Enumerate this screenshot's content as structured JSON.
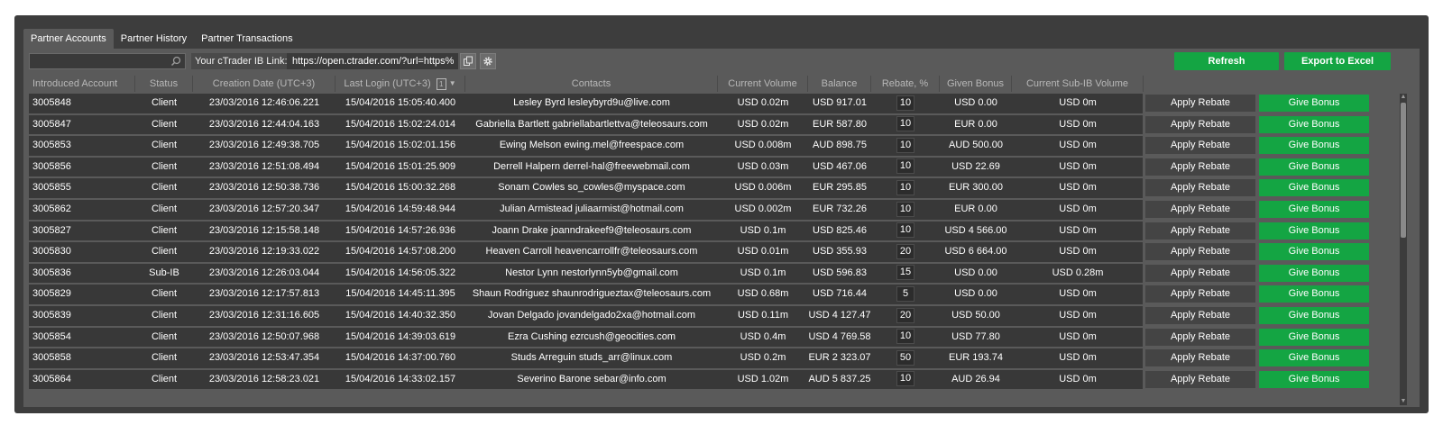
{
  "tabs": [
    {
      "label": "Partner Accounts",
      "active": true
    },
    {
      "label": "Partner History",
      "active": false
    },
    {
      "label": "Partner Transactions",
      "active": false
    }
  ],
  "toolbar": {
    "search_value": "",
    "ib_link_label": "Your cTrader IB Link:",
    "ib_link_value": "https://open.ctrader.com/?url=https%",
    "refresh_label": "Refresh",
    "export_label": "Export to Excel"
  },
  "table": {
    "columns": {
      "account": "Introduced Account",
      "status": "Status",
      "created": "Creation Date (UTC+3)",
      "last_login": "Last Login (UTC+3)",
      "sort_badge": "1",
      "contacts": "Contacts",
      "volume": "Current Volume",
      "balance": "Balance",
      "rebate": "Rebate, %",
      "bonus": "Given Bonus",
      "subib": "Current Sub-IB Volume"
    },
    "apply_label": "Apply Rebate",
    "bonus_label": "Give Bonus",
    "rows": [
      {
        "account": "3005848",
        "status": "Client",
        "created": "23/03/2016 12:46:06.221",
        "last_login": "15/04/2016 15:05:40.400",
        "contacts": "Lesley Byrd lesleybyrd9u@live.com",
        "volume": "USD 0.02m",
        "balance": "USD 917.01",
        "rebate": "10",
        "bonus": "USD 0.00",
        "subib": "USD 0m"
      },
      {
        "account": "3005847",
        "status": "Client",
        "created": "23/03/2016 12:44:04.163",
        "last_login": "15/04/2016 15:02:24.014",
        "contacts": "Gabriella Bartlett gabriellabartlettva@teleosaurs.com",
        "volume": "USD 0.02m",
        "balance": "EUR 587.80",
        "rebate": "10",
        "bonus": "EUR 0.00",
        "subib": "USD 0m"
      },
      {
        "account": "3005853",
        "status": "Client",
        "created": "23/03/2016 12:49:38.705",
        "last_login": "15/04/2016 15:02:01.156",
        "contacts": "Ewing Melson ewing.mel@freespace.com",
        "volume": "USD 0.008m",
        "balance": "AUD 898.75",
        "rebate": "10",
        "bonus": "AUD 500.00",
        "subib": "USD 0m"
      },
      {
        "account": "3005856",
        "status": "Client",
        "created": "23/03/2016 12:51:08.494",
        "last_login": "15/04/2016 15:01:25.909",
        "contacts": "Derrell Halpern derrel-hal@freewebmail.com",
        "volume": "USD 0.03m",
        "balance": "USD 467.06",
        "rebate": "10",
        "bonus": "USD 22.69",
        "subib": "USD 0m"
      },
      {
        "account": "3005855",
        "status": "Client",
        "created": "23/03/2016 12:50:38.736",
        "last_login": "15/04/2016 15:00:32.268",
        "contacts": "Sonam Cowles so_cowles@myspace.com",
        "volume": "USD 0.006m",
        "balance": "EUR 295.85",
        "rebate": "10",
        "bonus": "EUR 300.00",
        "subib": "USD 0m"
      },
      {
        "account": "3005862",
        "status": "Client",
        "created": "23/03/2016 12:57:20.347",
        "last_login": "15/04/2016 14:59:48.944",
        "contacts": "Julian Armistead juliaarmist@hotmail.com",
        "volume": "USD 0.002m",
        "balance": "EUR 732.26",
        "rebate": "10",
        "bonus": "EUR 0.00",
        "subib": "USD 0m"
      },
      {
        "account": "3005827",
        "status": "Client",
        "created": "23/03/2016 12:15:58.148",
        "last_login": "15/04/2016 14:57:26.936",
        "contacts": "Joann Drake joanndrakeef9@teleosaurs.com",
        "volume": "USD 0.1m",
        "balance": "USD 825.46",
        "rebate": "10",
        "bonus": "USD 4 566.00",
        "subib": "USD 0m"
      },
      {
        "account": "3005830",
        "status": "Client",
        "created": "23/03/2016 12:19:33.022",
        "last_login": "15/04/2016 14:57:08.200",
        "contacts": "Heaven Carroll heavencarrollfr@teleosaurs.com",
        "volume": "USD 0.01m",
        "balance": "USD 355.93",
        "rebate": "20",
        "bonus": "USD 6 664.00",
        "subib": "USD 0m"
      },
      {
        "account": "3005836",
        "status": "Sub-IB",
        "created": "23/03/2016 12:26:03.044",
        "last_login": "15/04/2016 14:56:05.322",
        "contacts": "Nestor Lynn nestorlynn5yb@gmail.com",
        "volume": "USD 0.1m",
        "balance": "USD 596.83",
        "rebate": "15",
        "bonus": "USD 0.00",
        "subib": "USD 0.28m"
      },
      {
        "account": "3005829",
        "status": "Client",
        "created": "23/03/2016 12:17:57.813",
        "last_login": "15/04/2016 14:45:11.395",
        "contacts": "Shaun Rodriguez shaunrodrigueztax@teleosaurs.com",
        "volume": "USD 0.68m",
        "balance": "USD 716.44",
        "rebate": "5",
        "bonus": "USD 0.00",
        "subib": "USD 0m"
      },
      {
        "account": "3005839",
        "status": "Client",
        "created": "23/03/2016 12:31:16.605",
        "last_login": "15/04/2016 14:40:32.350",
        "contacts": "Jovan Delgado jovandelgado2xa@hotmail.com",
        "volume": "USD 0.11m",
        "balance": "USD 4 127.47",
        "rebate": "20",
        "bonus": "USD 50.00",
        "subib": "USD 0m"
      },
      {
        "account": "3005854",
        "status": "Client",
        "created": "23/03/2016 12:50:07.968",
        "last_login": "15/04/2016 14:39:03.619",
        "contacts": "Ezra Cushing ezrcush@geocities.com",
        "volume": "USD 0.4m",
        "balance": "USD 4 769.58",
        "rebate": "10",
        "bonus": "USD 77.80",
        "subib": "USD 0m"
      },
      {
        "account": "3005858",
        "status": "Client",
        "created": "23/03/2016 12:53:47.354",
        "last_login": "15/04/2016 14:37:00.760",
        "contacts": "Studs Arreguin studs_arr@linux.com",
        "volume": "USD 0.2m",
        "balance": "EUR 2 323.07",
        "rebate": "50",
        "bonus": "EUR 193.74",
        "subib": "USD 0m"
      },
      {
        "account": "3005864",
        "status": "Client",
        "created": "23/03/2016 12:58:23.021",
        "last_login": "15/04/2016 14:33:02.157",
        "contacts": "Severino Barone sebar@info.com",
        "volume": "USD 1.02m",
        "balance": "AUD 5 837.25",
        "rebate": "10",
        "bonus": "AUD 26.94",
        "subib": "USD 0m"
      }
    ]
  },
  "colors": {
    "accent_green": "#14a543",
    "panel": "#5a5a5a",
    "frame": "#3d3d3d",
    "row": "#383838"
  },
  "icons": {
    "search": "search-icon",
    "copy": "copy-icon",
    "settings": "gear-icon",
    "sort": "sort-desc-icon"
  }
}
